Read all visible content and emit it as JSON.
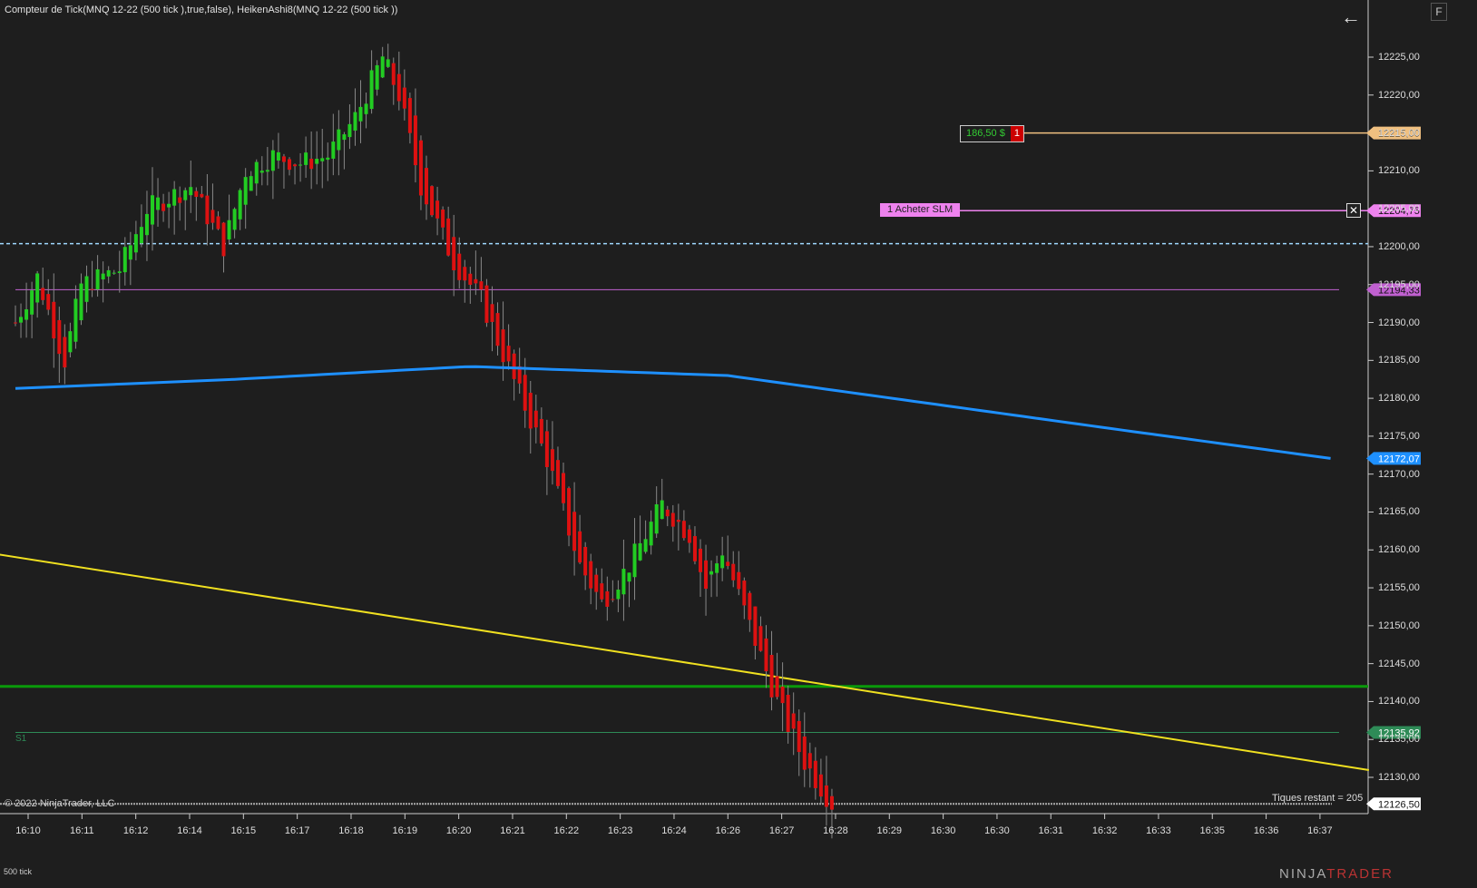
{
  "title": "Compteur de Tick(MNQ 12-22 (500 tick ),true,false), HeikenAshi8(MNQ 12-22 (500 tick ))",
  "buttons": {
    "back": "←",
    "f": "F"
  },
  "copyright": "© 2022 NinjaTrader, LLC",
  "remaining": "Tiques restant = 205",
  "period": "500 tick",
  "brand": {
    "a": "NINJA",
    "b": "TRADER"
  },
  "colors": {
    "up": "#22cc22",
    "down": "#dd1111",
    "ma": "#1e90ff",
    "trend": "#f0e020",
    "support": "#0a9a0a",
    "s1": "#2e8b57",
    "pivot": "#c060d0",
    "target": "#f0c080",
    "order": "#ee82ee",
    "dashed": "#9fd8ff"
  },
  "price_axis": {
    "min": 12130,
    "max": 12225,
    "step": 5
  },
  "time_labels": [
    "16:10",
    "16:11",
    "16:12",
    "16:14",
    "16:15",
    "16:17",
    "16:18",
    "16:19",
    "16:20",
    "16:21",
    "16:22",
    "16:23",
    "16:24",
    "16:26",
    "16:27",
    "16:28",
    "16:29",
    "16:30",
    "16:30",
    "16:31",
    "16:32",
    "16:33",
    "16:35",
    "16:36",
    "16:37"
  ],
  "price_path": [
    [
      0,
      12190
    ],
    [
      4,
      12196
    ],
    [
      8,
      12187
    ],
    [
      9,
      12185
    ],
    [
      12,
      12195
    ],
    [
      19,
      12197
    ],
    [
      24,
      12205
    ],
    [
      32,
      12208
    ],
    [
      38,
      12200
    ],
    [
      42,
      12210
    ],
    [
      47,
      12212
    ],
    [
      52,
      12211
    ],
    [
      57,
      12212
    ],
    [
      62,
      12217
    ],
    [
      67,
      12225
    ],
    [
      70,
      12220
    ],
    [
      74,
      12208
    ],
    [
      80,
      12198
    ],
    [
      85,
      12193
    ],
    [
      90,
      12184
    ],
    [
      97,
      12172
    ],
    [
      103,
      12158
    ],
    [
      107,
      12153
    ],
    [
      112,
      12158
    ],
    [
      118,
      12166
    ],
    [
      123,
      12162
    ],
    [
      126,
      12155
    ],
    [
      129,
      12160
    ],
    [
      134,
      12150
    ],
    [
      139,
      12140
    ],
    [
      144,
      12132
    ],
    [
      149,
      12126.5
    ]
  ],
  "ma_path": [
    [
      0,
      12181.3
    ],
    [
      40,
      12182.5
    ],
    [
      83,
      12184.2
    ],
    [
      130,
      12183
    ],
    [
      160,
      12180
    ],
    [
      200,
      12176
    ],
    [
      240,
      12172.07
    ]
  ],
  "trend_line": [
    [
      -3,
      12159.4
    ],
    [
      247,
      12130.96
    ]
  ],
  "levels": {
    "dashed": 12200.4,
    "pivot": {
      "value": 12194.33,
      "label": "12194,33"
    },
    "support": 12142.0,
    "s1": {
      "value": 12135.92,
      "label": "12135,92",
      "name": "S1"
    },
    "target": {
      "value": 12215.0,
      "label": "12215,00",
      "pnl": "186,50 $",
      "qty": "1"
    },
    "order": {
      "value": 12204.75,
      "label": "12204,75",
      "text": "1  Acheter SLM",
      "close": "✕"
    },
    "ma_label": "12172,07",
    "last": {
      "value": 12126.5,
      "label": "12126,50"
    }
  }
}
